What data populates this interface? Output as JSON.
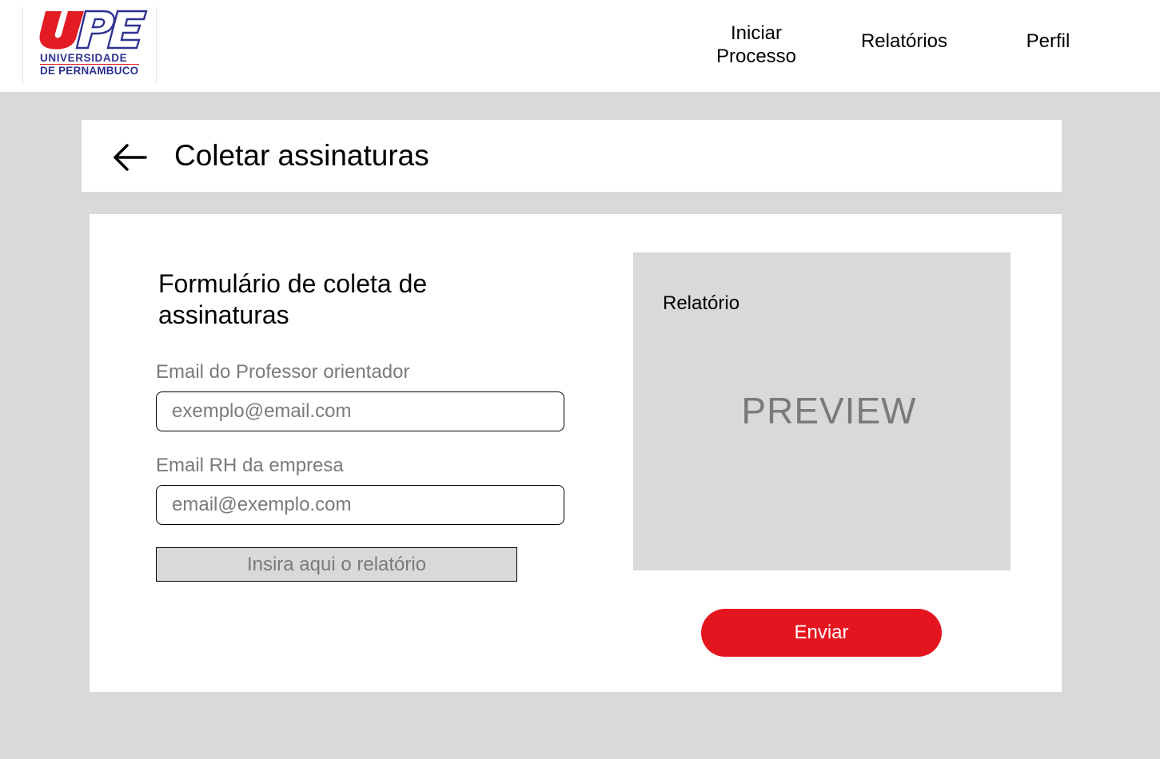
{
  "header": {
    "logo": {
      "mark": "UPE",
      "line1": "UNIVERSIDADE",
      "line2": "DE PERNAMBUCO"
    },
    "nav": {
      "iniciar_line1": "Iniciar",
      "iniciar_line2": "Processo",
      "relatorios": "Relatórios",
      "perfil": "Perfil"
    }
  },
  "title_bar": {
    "back_icon": "arrow-left-icon",
    "title": "Coletar assinaturas"
  },
  "form": {
    "title": "Formulário de coleta de assinaturas",
    "professor_label": "Email do Professor orientador",
    "professor_placeholder": "exemplo@email.com",
    "professor_value": "",
    "rh_label": "Email RH da empresa",
    "rh_placeholder": "email@exemplo.com",
    "rh_value": "",
    "upload_label": "Insira aqui o relatório"
  },
  "preview": {
    "label": "Relatório",
    "placeholder": "PREVIEW"
  },
  "actions": {
    "submit_label": "Enviar"
  },
  "colors": {
    "brand_red": "#e51520",
    "brand_blue": "#2e3192",
    "page_background": "#d9d9d9",
    "muted_text": "#7a7a7a"
  }
}
